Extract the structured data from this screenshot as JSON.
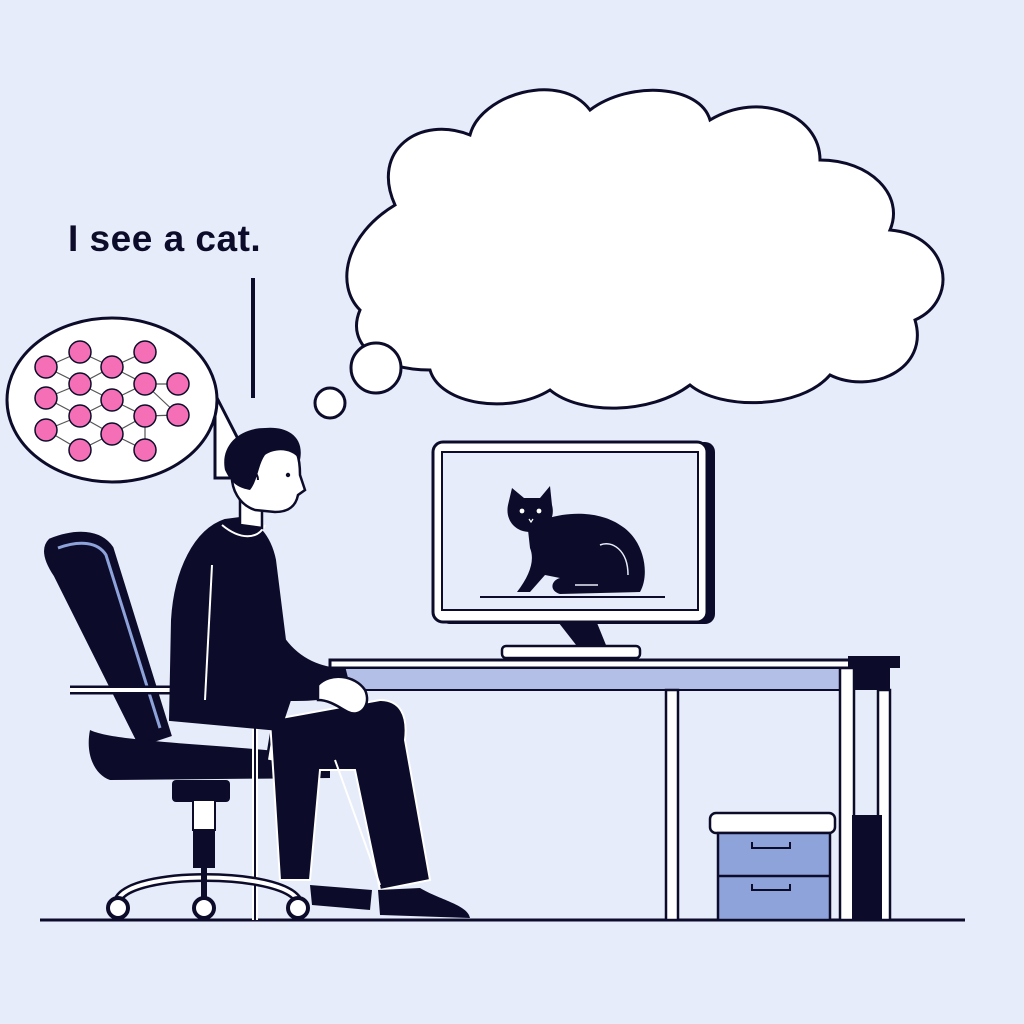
{
  "speech": {
    "text": "I see a cat."
  },
  "colors": {
    "background": "#e6ecf9",
    "outline": "#0c0c2a",
    "neuron": "#f46fb6",
    "drawer": "#8ea3da",
    "desk_shadow": "#b4bfe8"
  },
  "icons": {
    "neural_network": "neural-network-icon",
    "cat": "cat-silhouette",
    "thought": "thought-cloud"
  }
}
